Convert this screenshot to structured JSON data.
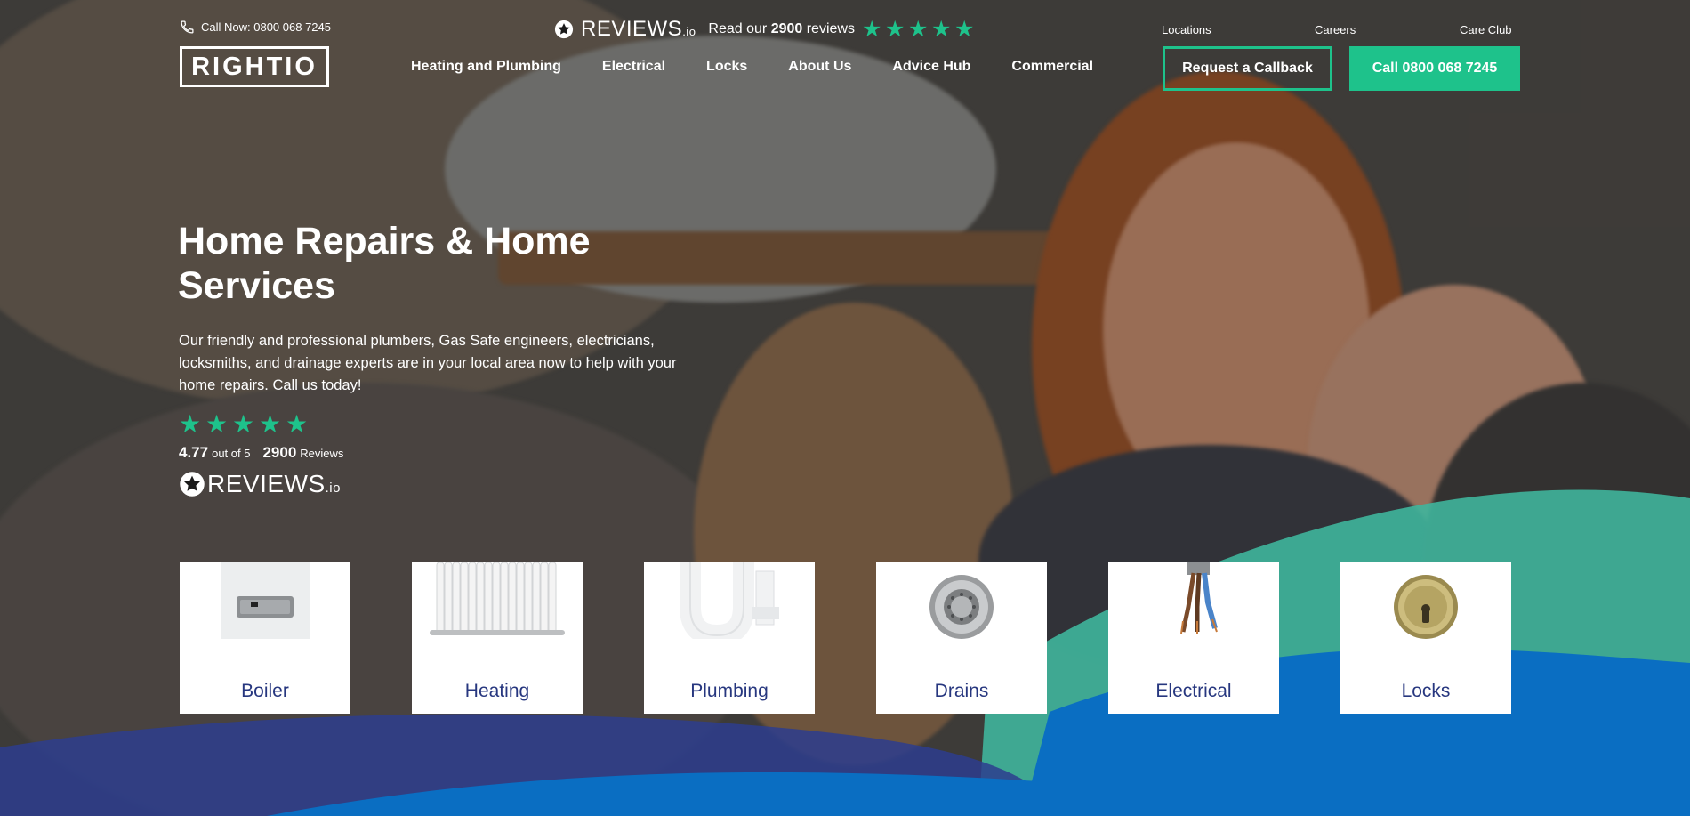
{
  "header": {
    "phone_text": "Call Now: 0800 068 7245",
    "logo_text": "RIGHTIO",
    "reviews_brand": "REVIEWS",
    "reviews_suffix": ".io",
    "read_our_prefix": "Read our ",
    "read_our_count": "2900",
    "read_our_suffix": " reviews",
    "star_rating": 5,
    "nav": [
      {
        "label": "Heating and Plumbing"
      },
      {
        "label": "Electrical"
      },
      {
        "label": "Locks"
      },
      {
        "label": "About Us"
      },
      {
        "label": "Advice Hub"
      },
      {
        "label": "Commercial"
      }
    ],
    "utility_links": {
      "locations": "Locations",
      "careers": "Careers",
      "care_club": "Care Club"
    },
    "request_callback_label": "Request a Callback",
    "call_button_label": "Call 0800 068 7245"
  },
  "hero": {
    "title": "Home Repairs & Home Services",
    "description": "Our friendly and professional plumbers, Gas Safe engineers, electricians, locksmiths, and drainage experts are in your local area now to help with your home repairs. Call us today!",
    "rating_value": "4.77",
    "rating_out_of": "out of 5",
    "review_count": "2900",
    "review_word": "Reviews",
    "reviews_brand": "REVIEWS",
    "reviews_suffix": ".io"
  },
  "services": [
    {
      "label": "Boiler",
      "icon": "boiler-image"
    },
    {
      "label": "Heating",
      "icon": "radiator-image"
    },
    {
      "label": "Plumbing",
      "icon": "pipe-image"
    },
    {
      "label": "Drains",
      "icon": "drain-image"
    },
    {
      "label": "Electrical",
      "icon": "wires-image"
    },
    {
      "label": "Locks",
      "icon": "lock-cylinder-image"
    }
  ],
  "colors": {
    "accent": "#1ec28b",
    "card_text": "#27377f",
    "wave_teal": "#3fb59c",
    "wave_blue": "#0a6ec2",
    "wave_navy": "#2d3d8e"
  }
}
